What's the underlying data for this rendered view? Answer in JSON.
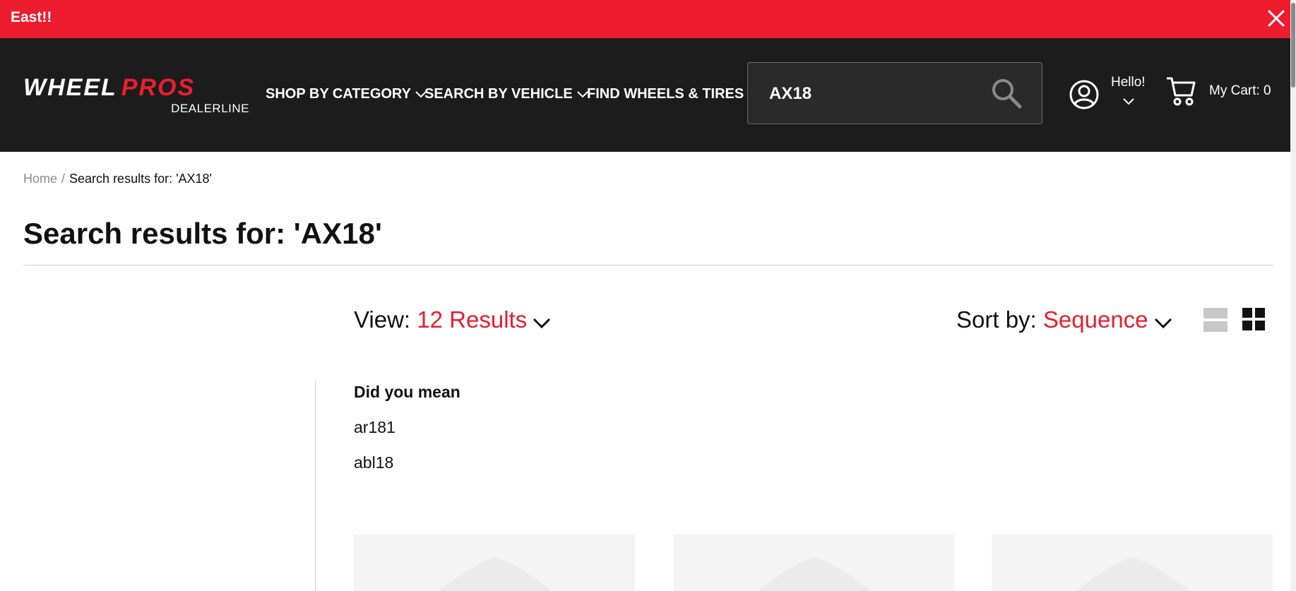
{
  "announcement": {
    "text": "East!!",
    "close_icon": "close-icon"
  },
  "header": {
    "logo": {
      "word1": "WHEEL",
      "word2": "PROS",
      "sub": "DEALERLINE"
    },
    "nav": [
      {
        "label": "SHOP BY CATEGORY",
        "has_dropdown": true
      },
      {
        "label": "SEARCH BY VEHICLE",
        "has_dropdown": true
      },
      {
        "label": "FIND WHEELS & TIRES",
        "has_dropdown": false
      }
    ],
    "search": {
      "value": "AX18",
      "icon": "search-icon"
    },
    "account": {
      "greeting": "Hello!",
      "icon": "account-icon"
    },
    "cart": {
      "label": "My Cart: 0",
      "icon": "cart-icon"
    }
  },
  "breadcrumb": {
    "home": "Home",
    "separator": "/",
    "current": "Search results for: 'AX18'"
  },
  "page_title": "Search results for: 'AX18'",
  "toolbar": {
    "view_label": "View:",
    "view_value": "12 Results",
    "sort_label": "Sort by:",
    "sort_value": "Sequence",
    "view_modes": [
      "list-view-icon",
      "grid-view-icon"
    ],
    "active_mode": "grid"
  },
  "did_you_mean": {
    "title": "Did you mean",
    "suggestions": [
      "ar181",
      "abl18"
    ]
  },
  "colors": {
    "accent": "#ed1c2e",
    "header_bg": "#1c1c1c",
    "tile_bg": "#f4f4f4"
  }
}
